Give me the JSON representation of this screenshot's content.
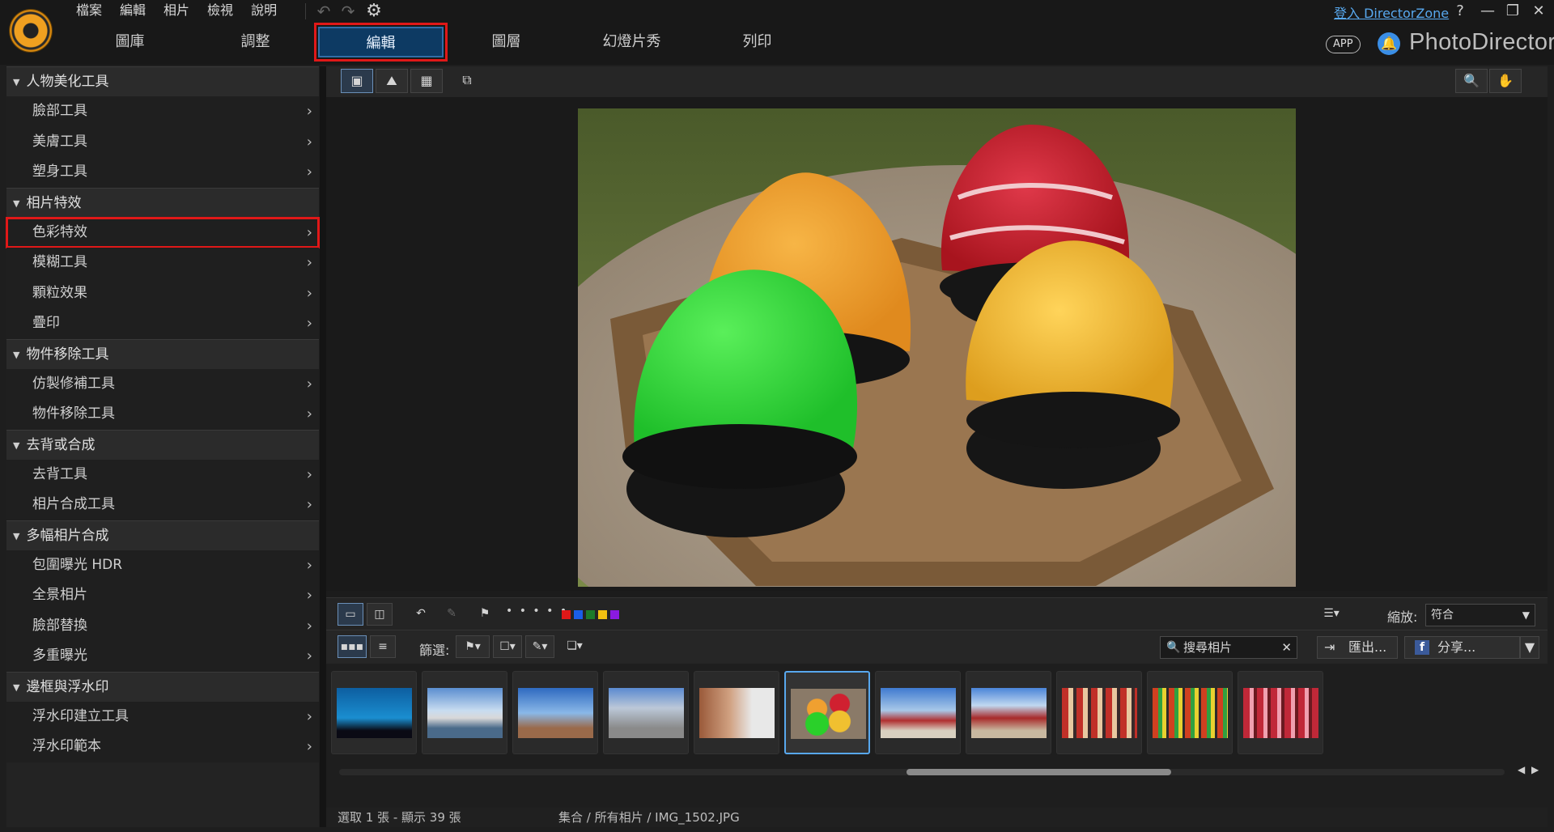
{
  "menus": [
    "檔案",
    "編輯",
    "相片",
    "檢視",
    "說明"
  ],
  "tabs": [
    "圖庫",
    "調整",
    "編輯",
    "圖層",
    "幻燈片秀",
    "列印"
  ],
  "active_tab": "編輯",
  "login_link": "登入 DirectorZone",
  "help": "?",
  "app_badge": "APP",
  "brand": "PhotoDirector",
  "sidebar": {
    "groups": [
      {
        "title": "人物美化工具",
        "items": [
          "臉部工具",
          "美膚工具",
          "塑身工具"
        ]
      },
      {
        "title": "相片特效",
        "items": [
          "色彩特效",
          "模糊工具",
          "顆粒效果",
          "疊印"
        ]
      },
      {
        "title": "物件移除工具",
        "items": [
          "仿製修補工具",
          "物件移除工具"
        ]
      },
      {
        "title": "去背或合成",
        "items": [
          "去背工具",
          "相片合成工具"
        ]
      },
      {
        "title": "多幅相片合成",
        "items": [
          "包圍曝光 HDR",
          "全景相片",
          "臉部替換",
          "多重曝光"
        ]
      },
      {
        "title": "邊框與浮水印",
        "items": [
          "浮水印建立工具",
          "浮水印範本"
        ]
      }
    ],
    "highlighted_item": "色彩特效"
  },
  "toolbar": {
    "dots": "• • • • •",
    "zoom_label": "縮放:",
    "zoom_value": "符合"
  },
  "filter_bar": {
    "filter_label": "篩選:",
    "search_text": "搜尋相片",
    "export_label": "匯出...",
    "share_label": "分享..."
  },
  "color_labels": [
    "#e01818",
    "#1a5ee8",
    "#1c7a2a",
    "#f0c010",
    "#8a1ae0"
  ],
  "status": {
    "selection": "選取 1 張 - 顯示 39 張",
    "path": "集合 / 所有相片 / IMG_1502.JPG"
  }
}
